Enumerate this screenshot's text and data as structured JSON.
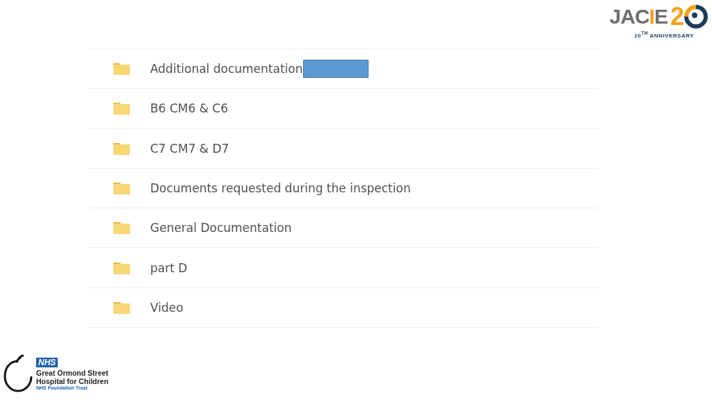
{
  "jacie_logo": {
    "name_parts": [
      {
        "text": "JAC",
        "accent": false
      },
      {
        "text": "I",
        "accent": true
      },
      {
        "text": "E",
        "accent": false
      }
    ],
    "number": "2",
    "tagline": "20$^{TH}$ ANNIVERSARY"
  },
  "folders": [
    {
      "name": "Additional documentation",
      "redacted": true
    },
    {
      "name": "B6 CM6 & C6",
      "redacted": false
    },
    {
      "name": "C7 CM7 & D7",
      "redacted": false
    },
    {
      "name": "Documents requested during the inspection",
      "redacted": false
    },
    {
      "name": "General Documentation",
      "redacted": false
    },
    {
      "name": "part D",
      "redacted": false
    },
    {
      "name": "Video",
      "redacted": false
    }
  ],
  "hospital_logo": {
    "badge": "NHS",
    "lines": [
      "Great Ormond Street",
      "Hospital for Children"
    ],
    "subtitle": "NHS Foundation Trust"
  }
}
